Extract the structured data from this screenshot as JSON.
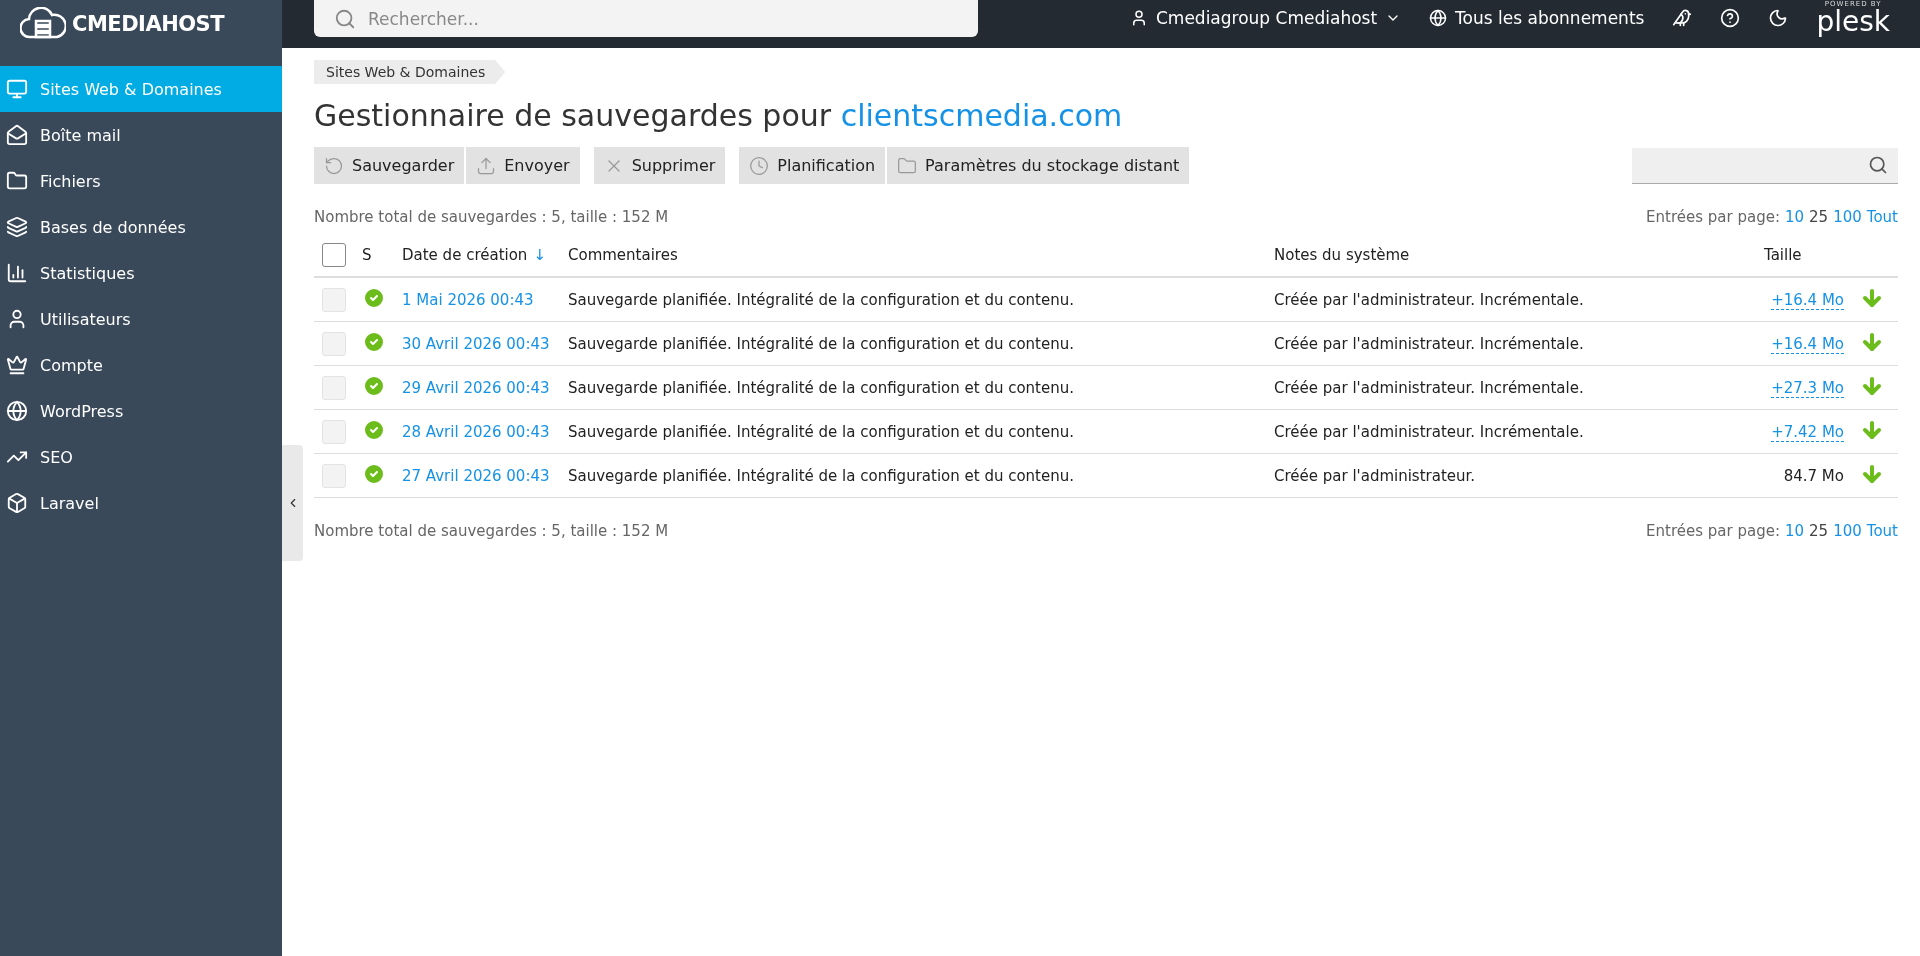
{
  "brand": {
    "name": "CMEDIAHOST"
  },
  "topbar": {
    "search_placeholder": "Rechercher...",
    "user": "Cmediagroup Cmediahost",
    "subscriptions": "Tous les abonnements",
    "powered_by": "POWERED BY",
    "plesk": "plesk"
  },
  "sidebar": {
    "items": [
      {
        "label": "Sites Web & Domaines",
        "selected": true
      },
      {
        "label": "Boîte mail",
        "selected": false
      },
      {
        "label": "Fichiers",
        "selected": false
      },
      {
        "label": "Bases de données",
        "selected": false
      },
      {
        "label": "Statistiques",
        "selected": false
      },
      {
        "label": "Utilisateurs",
        "selected": false
      },
      {
        "label": "Compte",
        "selected": false
      },
      {
        "label": "WordPress",
        "selected": false
      },
      {
        "label": "SEO",
        "selected": false
      },
      {
        "label": "Laravel",
        "selected": false
      }
    ]
  },
  "breadcrumb": "Sites Web & Domaines",
  "title": {
    "text": "Gestionnaire de sauvegardes pour ",
    "domain": "clientscmedia.com"
  },
  "toolbar": [
    [
      "Sauvegarder",
      "Envoyer"
    ],
    [
      "Supprimer"
    ],
    [
      "Planification",
      "Paramètres du stockage distant"
    ]
  ],
  "summary_top": "Nombre total de sauvegardes : 5, taille : 152 M",
  "pager_top": {
    "label": "Entrées par page:",
    "options": [
      {
        "label": "10",
        "selected": false
      },
      {
        "label": "25",
        "selected": true
      },
      {
        "label": "100",
        "selected": false
      },
      {
        "label": "Tout",
        "selected": false
      }
    ]
  },
  "table": {
    "select_all": {
      "checked": false
    },
    "columns": [
      "S",
      "Date de création",
      "Commentaires",
      "Notes du système",
      "Taille"
    ],
    "sort_mark": "↓",
    "rows": [
      {
        "checked": false,
        "date": "1 Mai 2026 00:43",
        "comment": "Sauvegarde planifiée. Intégralité de la configuration et du contenu.",
        "notes": "Créée par l'administrateur. Incrémentale.",
        "size": "+16.4 Mo",
        "kind": "link"
      },
      {
        "checked": false,
        "date": "30 Avril 2026 00:43",
        "comment": "Sauvegarde planifiée. Intégralité de la configuration et du contenu.",
        "notes": "Créée par l'administrateur. Incrémentale.",
        "size": "+16.4 Mo",
        "kind": "link"
      },
      {
        "checked": false,
        "date": "29 Avril 2026 00:43",
        "comment": "Sauvegarde planifiée. Intégralité de la configuration et du contenu.",
        "notes": "Créée par l'administrateur. Incrémentale.",
        "size": "+27.3 Mo",
        "kind": "link"
      },
      {
        "checked": false,
        "date": "28 Avril 2026 00:43",
        "comment": "Sauvegarde planifiée. Intégralité de la configuration et du contenu.",
        "notes": "Créée par l'administrateur. Incrémentale.",
        "size": "+7.42 Mo",
        "kind": "link"
      },
      {
        "checked": false,
        "date": "27 Avril 2026 00:43",
        "comment": "Sauvegarde planifiée. Intégralité de la configuration et du contenu.",
        "notes": "Créée par l'administrateur.",
        "size": "84.7 Mo",
        "kind": "plain"
      }
    ]
  },
  "summary_bottom": "Nombre total de sauvegardes : 5, taille : 152 M",
  "pager_bottom": {
    "label": "Entrées par page:",
    "options": [
      {
        "label": "10",
        "selected": false
      },
      {
        "label": "25",
        "selected": true
      },
      {
        "label": "100",
        "selected": false
      },
      {
        "label": "Tout",
        "selected": false
      }
    ]
  }
}
